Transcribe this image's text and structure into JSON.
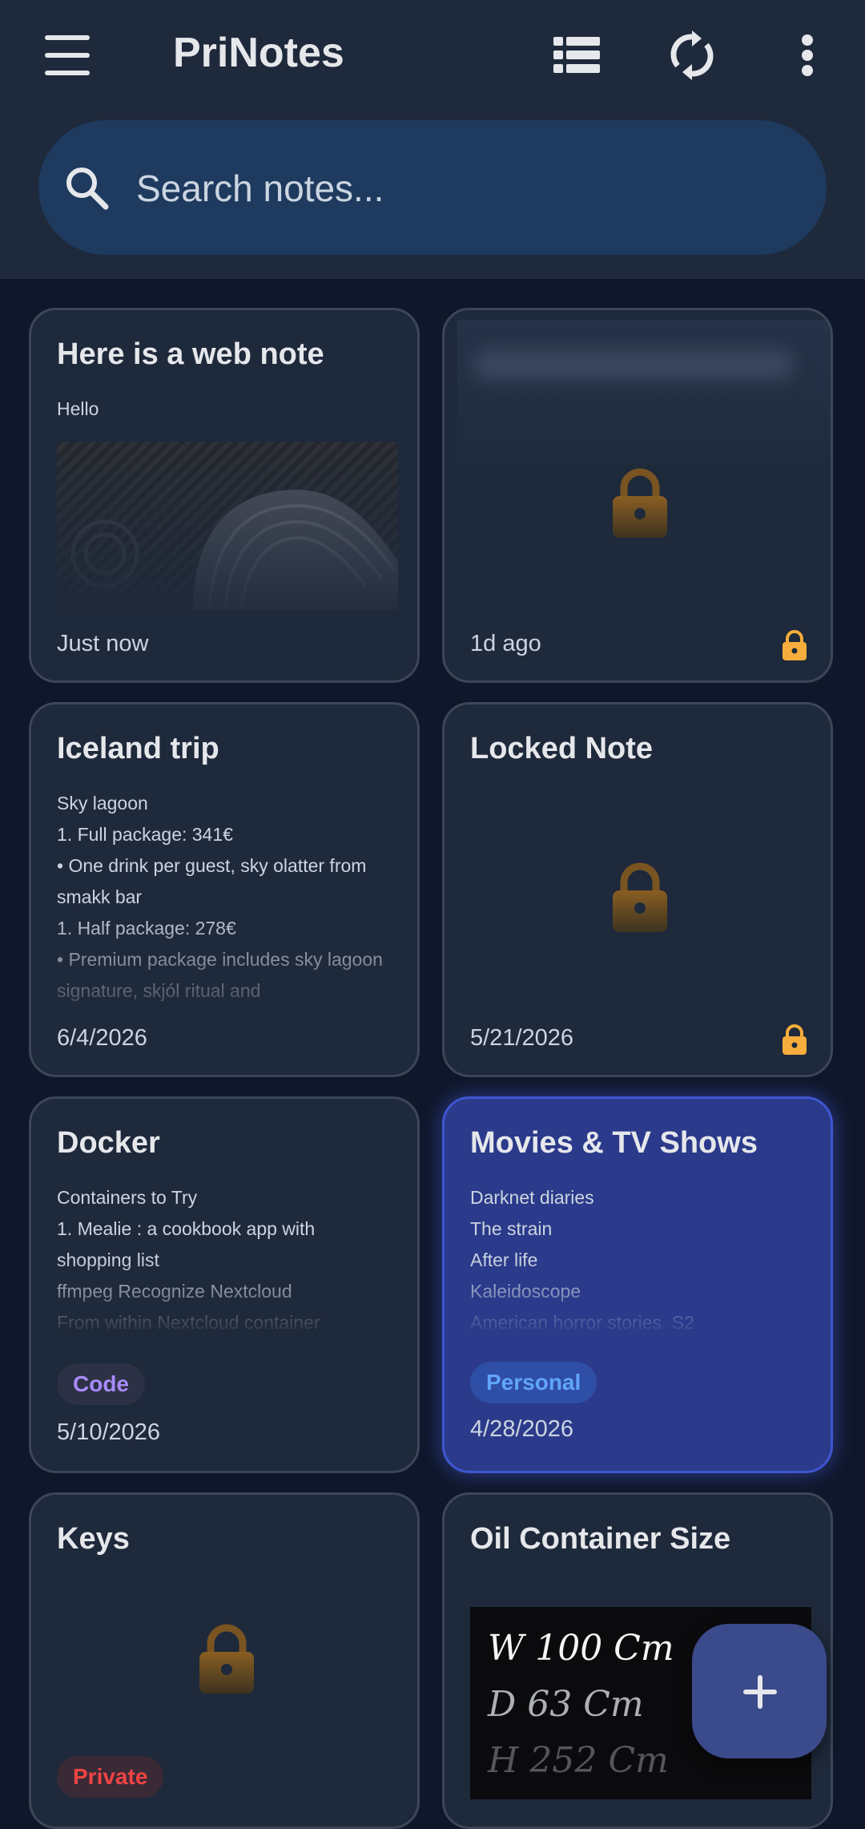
{
  "app": {
    "title": "PriNotes",
    "icons": {
      "menu": "hamburger-menu-icon",
      "layout": "list-view-icon",
      "sync": "sync-icon",
      "more": "more-vertical-icon"
    }
  },
  "search": {
    "placeholder": "Search notes..."
  },
  "notes": [
    {
      "title": "Here is a web note",
      "lines": [
        "Hello"
      ],
      "date": "Just now",
      "has_image": true
    },
    {
      "title": "",
      "date": "1d ago",
      "locked": true
    },
    {
      "title": "Iceland trip",
      "lines": [
        "Sky lagoon",
        "1. Full package: 341€",
        "• One drink per guest, sky olatter from smakk bar",
        "1. Half package: 278€",
        "• Premium package includes sky lagoon signature, skjól ritual and"
      ],
      "date": "6/4/2026"
    },
    {
      "title": "Locked Note",
      "date": "5/21/2026",
      "locked": true
    },
    {
      "title": "Docker",
      "lines": [
        "Containers to Try",
        "1. Mealie : a cookbook app with shopping list",
        "ffmpeg Recognize Nextcloud",
        "From within Nextcloud container"
      ],
      "tag": "Code",
      "date": "5/10/2026"
    },
    {
      "title": "Movies & TV Shows",
      "lines": [
        "Darknet diaries",
        "The strain",
        "After life",
        "Kaleidoscope",
        "American horror stories. S2"
      ],
      "tag": "Personal",
      "date": "4/28/2026"
    },
    {
      "title": "Keys",
      "tag": "Private",
      "locked": true
    },
    {
      "title": "Oil Container Size",
      "handwriting": [
        "W 100 Cm",
        "D 63 Cm",
        "H 252 Cm"
      ]
    }
  ],
  "colors": {
    "background": "#0f172a",
    "card": "#1e293b",
    "highlight_card": "#2b3a8a",
    "lock": "#f6ad3b",
    "code_tag": "#a78bfa",
    "personal_tag": "#60a5fa",
    "private_tag": "#ef4444"
  },
  "fab": {
    "icon": "plus-icon"
  }
}
